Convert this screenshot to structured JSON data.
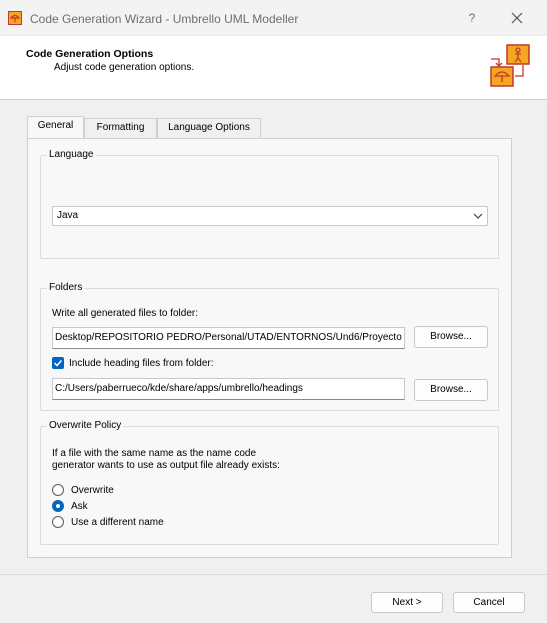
{
  "window": {
    "title": "Code Generation Wizard - Umbrello UML Modeller",
    "help_glyph": "?",
    "icon": "umbrello-app-icon",
    "close_icon": "close-icon"
  },
  "header": {
    "title": "Code Generation Options",
    "subtitle": "Adjust code generation options.",
    "logo_icon": "umbrello-wizard-logo"
  },
  "tabs": [
    {
      "label": "General",
      "active": true
    },
    {
      "label": "Formatting",
      "active": false
    },
    {
      "label": "Language Options",
      "active": false
    }
  ],
  "language_group": {
    "title": "Language",
    "selected": "Java"
  },
  "folders_group": {
    "title": "Folders",
    "output_label": "Write all generated files to folder:",
    "output_path": "Desktop/REPOSITORIO PEDRO/Personal/UTAD/ENTORNOS/Und6/Proyecto",
    "browse_label": "Browse...",
    "include_heading": {
      "label": "Include heading files from folder:",
      "checked": true
    },
    "heading_path": "C:/Users/paberrueco/kde/share/apps/umbrello/headings",
    "browse2_label": "Browse..."
  },
  "overwrite_group": {
    "title": "Overwrite Policy",
    "description_line1": "If a file with the same name as the name code",
    "description_line2": "generator wants to use as output file already exists:",
    "options": [
      {
        "label": "Overwrite",
        "checked": false
      },
      {
        "label": "Ask",
        "checked": true
      },
      {
        "label": "Use a different name",
        "checked": false
      }
    ]
  },
  "footer": {
    "next_label": "Next >",
    "cancel_label": "Cancel"
  },
  "colors": {
    "accent": "#0067c0",
    "logo_orange": "#f5a623",
    "logo_red": "#c0392b"
  }
}
